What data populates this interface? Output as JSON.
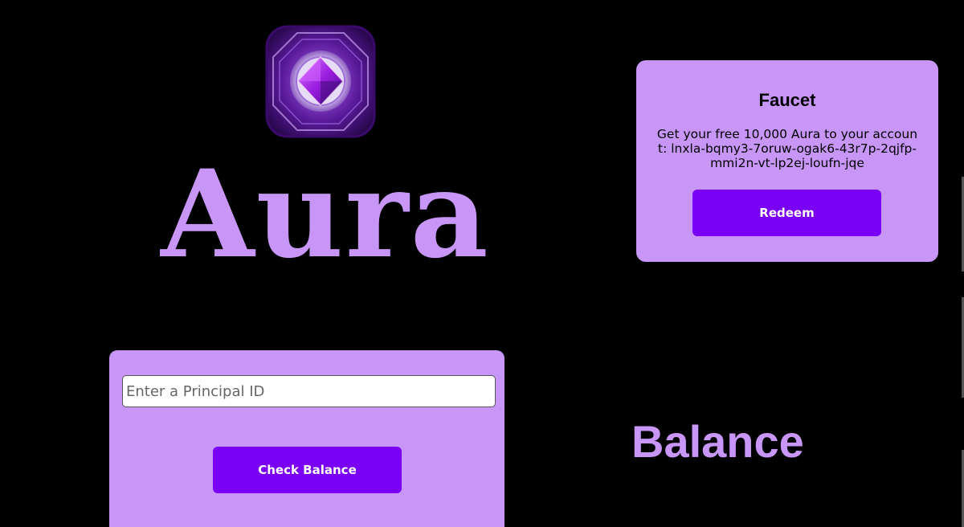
{
  "brand": {
    "title": "Aura",
    "logo_icon": "purple-gem-token-icon"
  },
  "faucet": {
    "title": "Faucet",
    "description": "Get your free 10,000 Aura to your account: lnxla-bqmy3-7oruw-ogak6-43r7p-2qjfp-mmi2n-vt-lp2ej-loufn-jqe",
    "redeem_label": "Redeem"
  },
  "balance_form": {
    "input_placeholder": "Enter a Principal ID",
    "input_value": "",
    "check_label": "Check Balance"
  },
  "balance": {
    "label": "Balance"
  },
  "colors": {
    "background": "#000000",
    "card": "#c796f7",
    "button": "#7a00f5",
    "accent_text": "#c796f7"
  }
}
